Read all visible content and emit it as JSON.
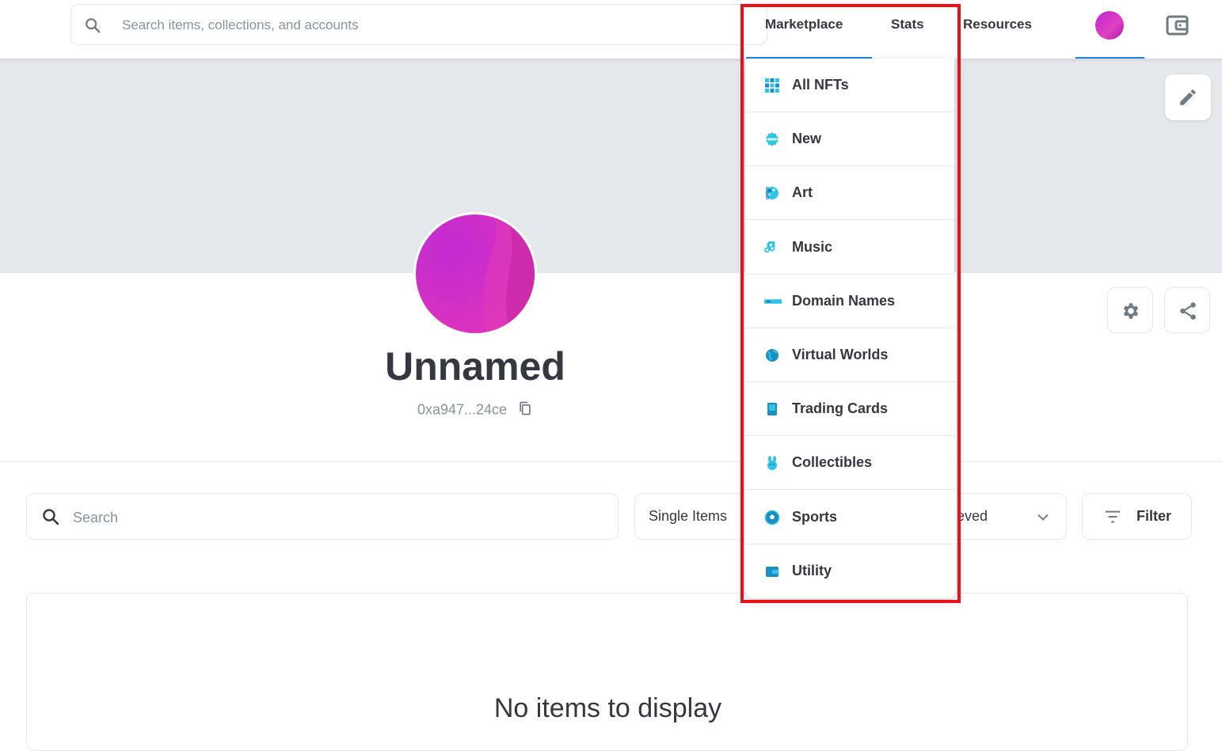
{
  "header": {
    "search_placeholder": "Search items, collections, and accounts",
    "nav": {
      "marketplace": "Marketplace",
      "stats": "Stats",
      "resources": "Resources"
    }
  },
  "profile": {
    "name": "Unnamed",
    "address": "0xa947...24ce"
  },
  "filters": {
    "search_placeholder": "Search",
    "type_select": "Single Items",
    "sort_select": "...eved",
    "filter_label": "Filter"
  },
  "empty_state": "No items to display",
  "dropdown": {
    "items": [
      {
        "label": "All NFTs",
        "icon": "grid-icon"
      },
      {
        "label": "New",
        "icon": "new-badge-icon"
      },
      {
        "label": "Art",
        "icon": "palette-icon"
      },
      {
        "label": "Music",
        "icon": "music-note-icon"
      },
      {
        "label": "Domain Names",
        "icon": "domain-bar-icon"
      },
      {
        "label": "Virtual Worlds",
        "icon": "globe-icon"
      },
      {
        "label": "Trading Cards",
        "icon": "card-icon"
      },
      {
        "label": "Collectibles",
        "icon": "bunny-icon"
      },
      {
        "label": "Sports",
        "icon": "ball-icon"
      },
      {
        "label": "Utility",
        "icon": "wallet-icon"
      }
    ]
  },
  "colors": {
    "accent": "#2081e2",
    "highlight": "#e8101a",
    "icon_teal": "#2ec4e6"
  }
}
